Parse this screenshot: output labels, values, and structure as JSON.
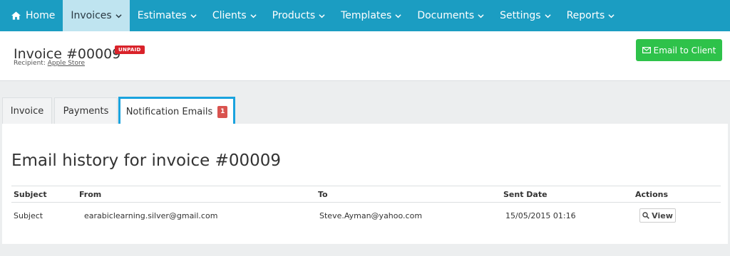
{
  "nav": {
    "items": [
      {
        "label": "Home"
      },
      {
        "label": "Invoices"
      },
      {
        "label": "Estimates"
      },
      {
        "label": "Clients"
      },
      {
        "label": "Products"
      },
      {
        "label": "Templates"
      },
      {
        "label": "Documents"
      },
      {
        "label": "Settings"
      },
      {
        "label": "Reports"
      }
    ],
    "active_label": "Invoices"
  },
  "header": {
    "title": "Invoice #00009",
    "status_badge": "UNPAID",
    "recipient_prefix": "Recipient:",
    "recipient_name": "Apple Store",
    "email_button": "Email to Client"
  },
  "tabs": [
    {
      "label": "Invoice"
    },
    {
      "label": "Payments"
    },
    {
      "label": "Notification Emails",
      "count": "1"
    }
  ],
  "panel": {
    "title": "Email history for invoice #00009",
    "columns": [
      "Subject",
      "From",
      "To",
      "Sent Date",
      "Actions"
    ],
    "rows": [
      {
        "subject": "Subject",
        "from": "earabiclearning.silver@gmail.com",
        "to": "Steve.Ayman@yahoo.com",
        "sent": "15/05/2015 01:16",
        "action": "View"
      }
    ]
  },
  "colors": {
    "nav_bg": "#1b9dc2",
    "active_tab_border": "#1aa3de",
    "unpaid": "#d9222a",
    "email_btn": "#2ec24a"
  }
}
